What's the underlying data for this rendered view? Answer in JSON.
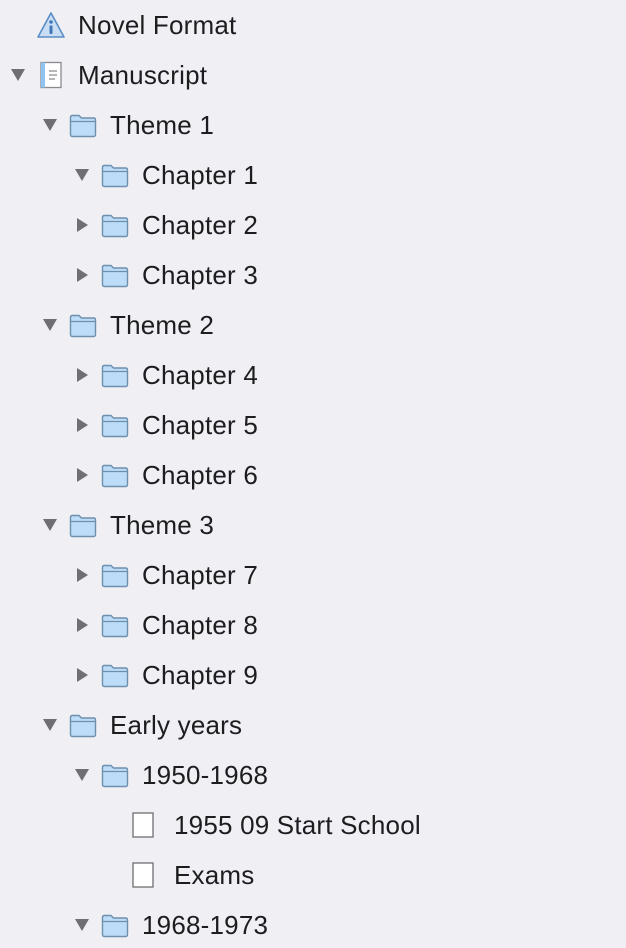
{
  "binder": {
    "items": [
      {
        "label": "Novel Format",
        "icon": "info-icon",
        "disclosure": "none",
        "level": 0
      },
      {
        "label": "Manuscript",
        "icon": "manuscript-icon",
        "disclosure": "expanded",
        "level": 0
      },
      {
        "label": "Theme 1",
        "icon": "folder-icon",
        "disclosure": "expanded",
        "level": 1
      },
      {
        "label": "Chapter 1",
        "icon": "folder-icon",
        "disclosure": "expanded",
        "level": 2
      },
      {
        "label": "Chapter 2",
        "icon": "folder-icon",
        "disclosure": "collapsed",
        "level": 2
      },
      {
        "label": "Chapter 3",
        "icon": "folder-icon",
        "disclosure": "collapsed",
        "level": 2
      },
      {
        "label": "Theme 2",
        "icon": "folder-icon",
        "disclosure": "expanded",
        "level": 1
      },
      {
        "label": "Chapter 4",
        "icon": "folder-icon",
        "disclosure": "collapsed",
        "level": 2
      },
      {
        "label": "Chapter 5",
        "icon": "folder-icon",
        "disclosure": "collapsed",
        "level": 2
      },
      {
        "label": "Chapter 6",
        "icon": "folder-icon",
        "disclosure": "collapsed",
        "level": 2
      },
      {
        "label": "Theme 3",
        "icon": "folder-icon",
        "disclosure": "expanded",
        "level": 1
      },
      {
        "label": "Chapter 7",
        "icon": "folder-icon",
        "disclosure": "collapsed",
        "level": 2
      },
      {
        "label": "Chapter 8",
        "icon": "folder-icon",
        "disclosure": "collapsed",
        "level": 2
      },
      {
        "label": "Chapter 9",
        "icon": "folder-icon",
        "disclosure": "collapsed",
        "level": 2
      },
      {
        "label": "Early years",
        "icon": "folder-icon",
        "disclosure": "expanded",
        "level": 1
      },
      {
        "label": "1950-1968",
        "icon": "folder-icon",
        "disclosure": "expanded",
        "level": 2
      },
      {
        "label": "1955 09 Start School",
        "icon": "document-icon",
        "disclosure": "none",
        "level": 3
      },
      {
        "label": "Exams",
        "icon": "document-icon",
        "disclosure": "none",
        "level": 3
      },
      {
        "label": "1968-1973",
        "icon": "folder-icon",
        "disclosure": "expanded",
        "level": 2
      }
    ]
  },
  "colors": {
    "background": "#efeff4",
    "folder_fill": "#bcdcf7",
    "folder_stroke": "#6f8fae",
    "disclosure": "#6e6e73",
    "text": "#1d1d1f"
  }
}
